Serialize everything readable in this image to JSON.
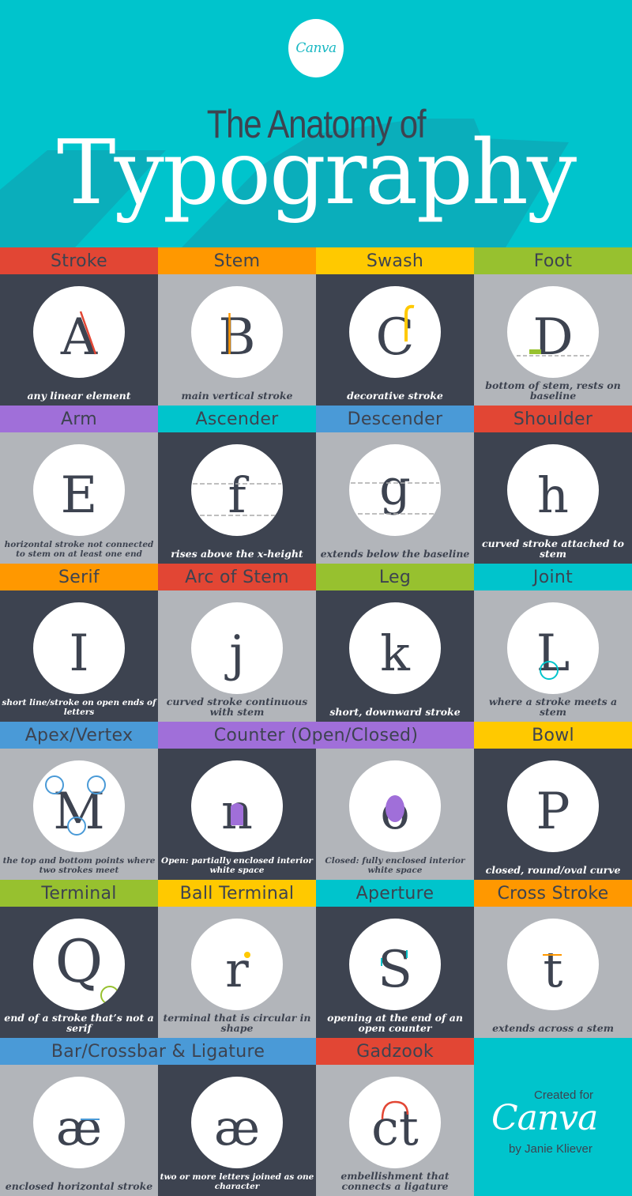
{
  "header": {
    "logo": "Canva",
    "title_line1": "The Anatomy of",
    "title_line2": "Typography"
  },
  "colors": {
    "teal": "#00c4cc",
    "dark": "#3d4350",
    "light": "#b2b5ba",
    "red": "#e24634",
    "orange": "#ff9800",
    "yellow": "#ffc900",
    "green": "#97c12f",
    "purple": "#a06fd9",
    "blue": "#4a9ad7"
  },
  "rows": [
    {
      "headers": [
        {
          "label": "Stroke",
          "color": "#e24634",
          "span": 1
        },
        {
          "label": "Stem",
          "color": "#ff9800",
          "span": 1
        },
        {
          "label": "Swash",
          "color": "#ffc900",
          "span": 1
        },
        {
          "label": "Foot",
          "color": "#97c12f",
          "span": 1
        }
      ],
      "cells": [
        {
          "glyph": "A",
          "highlight": "#e24634",
          "desc": "any linear element",
          "bg": "dark"
        },
        {
          "glyph": "B",
          "highlight": "#ff9800",
          "desc": "main vertical stroke",
          "bg": "light"
        },
        {
          "glyph": "C",
          "highlight": "#ffc900",
          "desc": "decorative stroke",
          "bg": "dark"
        },
        {
          "glyph": "D",
          "highlight": "#97c12f",
          "desc": "bottom of stem, rests on baseline",
          "bg": "light"
        }
      ]
    },
    {
      "headers": [
        {
          "label": "Arm",
          "color": "#a06fd9",
          "span": 1
        },
        {
          "label": "Ascender",
          "color": "#00c4cc",
          "span": 1
        },
        {
          "label": "Descender",
          "color": "#4a9ad7",
          "span": 1
        },
        {
          "label": "Shoulder",
          "color": "#e24634",
          "span": 1
        }
      ],
      "cells": [
        {
          "glyph": "E",
          "highlight": "#a06fd9",
          "desc": "horizontal stroke not connected to stem on at least one end",
          "bg": "light"
        },
        {
          "glyph": "f",
          "highlight": "#00c4cc",
          "desc": "rises above the x-height",
          "bg": "dark"
        },
        {
          "glyph": "g",
          "highlight": "#4a9ad7",
          "desc": "extends below the baseline",
          "bg": "light"
        },
        {
          "glyph": "h",
          "highlight": "#e24634",
          "desc": "curved stroke attached to stem",
          "bg": "dark"
        }
      ]
    },
    {
      "headers": [
        {
          "label": "Serif",
          "color": "#ff9800",
          "span": 1
        },
        {
          "label": "Arc of Stem",
          "color": "#e24634",
          "span": 1
        },
        {
          "label": "Leg",
          "color": "#97c12f",
          "span": 1
        },
        {
          "label": "Joint",
          "color": "#00c4cc",
          "span": 1
        }
      ],
      "cells": [
        {
          "glyph": "I",
          "highlight": "#ff9800",
          "desc": "short line/stroke on open ends of letters",
          "bg": "dark"
        },
        {
          "glyph": "j",
          "highlight": "#e24634",
          "desc": "curved stroke continuous with stem",
          "bg": "light"
        },
        {
          "glyph": "k",
          "highlight": "#97c12f",
          "desc": "short, downward stroke",
          "bg": "dark"
        },
        {
          "glyph": "L",
          "highlight": "#00c4cc",
          "desc": "where a stroke meets a stem",
          "bg": "light"
        }
      ]
    },
    {
      "headers": [
        {
          "label": "Apex/Vertex",
          "color": "#4a9ad7",
          "span": 1
        },
        {
          "label": "Counter (Open/Closed)",
          "color": "#a06fd9",
          "span": 2
        },
        {
          "label": "Bowl",
          "color": "#ffc900",
          "span": 1
        }
      ],
      "cells": [
        {
          "glyph": "M",
          "highlight": "#4a9ad7",
          "desc": "the top and bottom points where two strokes meet",
          "bg": "light"
        },
        {
          "glyph": "n",
          "highlight": "#a06fd9",
          "desc": "Open: partially enclosed interior white space",
          "bg": "dark"
        },
        {
          "glyph": "o",
          "highlight": "#a06fd9",
          "desc": "Closed: fully enclosed interior white space",
          "bg": "light"
        },
        {
          "glyph": "P",
          "highlight": "#ffc900",
          "desc": "closed, round/oval curve",
          "bg": "dark"
        }
      ]
    },
    {
      "headers": [
        {
          "label": "Terminal",
          "color": "#97c12f",
          "span": 1
        },
        {
          "label": "Ball Terminal",
          "color": "#ffc900",
          "span": 1
        },
        {
          "label": "Aperture",
          "color": "#00c4cc",
          "span": 1
        },
        {
          "label": "Cross Stroke",
          "color": "#ff9800",
          "span": 1
        }
      ],
      "cells": [
        {
          "glyph": "Q",
          "highlight": "#97c12f",
          "desc": "end of a stroke that’s not a serif",
          "bg": "dark"
        },
        {
          "glyph": "r",
          "highlight": "#ffc900",
          "desc": "terminal that is circular in shape",
          "bg": "light"
        },
        {
          "glyph": "S",
          "highlight": "#00c4cc",
          "desc": "opening at the end of an open counter",
          "bg": "dark"
        },
        {
          "glyph": "t",
          "highlight": "#ff9800",
          "desc": "extends across a stem",
          "bg": "light"
        }
      ]
    },
    {
      "headers": [
        {
          "label": "Bar/Crossbar  &  Ligature",
          "color": "#4a9ad7",
          "span": 2
        },
        {
          "label": "Gadzook",
          "color": "#e24634",
          "span": 1
        }
      ],
      "cells": [
        {
          "glyph": "æ",
          "highlight": "#4a9ad7",
          "desc": "enclosed horizontal stroke",
          "bg": "light"
        },
        {
          "glyph": "æ",
          "highlight": "#4a9ad7",
          "desc": "two or more letters joined as one character",
          "bg": "dark"
        },
        {
          "glyph": "ct",
          "highlight": "#e24634",
          "desc": "embellishment that connects a ligature",
          "bg": "light"
        }
      ]
    }
  ],
  "credit": {
    "created_for": "Created for",
    "brand": "Canva",
    "author": "by Janie Kliever"
  }
}
